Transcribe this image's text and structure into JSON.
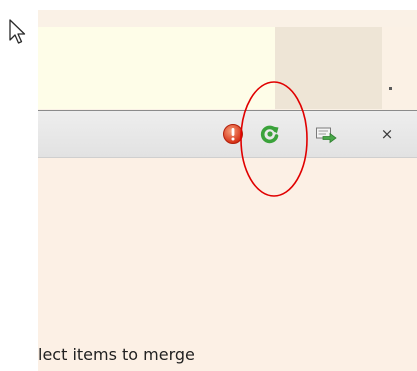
{
  "toolbar": {
    "icons": [
      "error-icon",
      "refresh-icon",
      "merge-icon",
      "close-icon"
    ],
    "close_glyph": "×"
  },
  "status": {
    "text": "lect items to merge"
  },
  "annotation": {
    "shape": "ellipse",
    "color": "#e00000"
  },
  "colors": {
    "upper_panel": "#fefde8",
    "content": "#fcf0e5",
    "error": "#e03a20",
    "refresh": "#3aa23a",
    "merge": "#4aa84a"
  }
}
